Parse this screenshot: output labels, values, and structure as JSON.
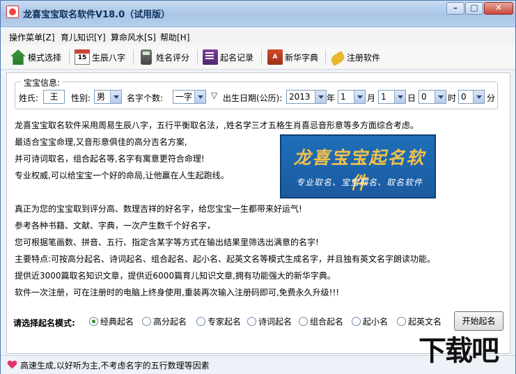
{
  "window": {
    "title": "龙喜宝宝取名软件V18.0（试用版）"
  },
  "menu": [
    {
      "label": "操作菜单[Z]"
    },
    {
      "label": "育儿知识[Y]"
    },
    {
      "label": "算命风水[S]"
    },
    {
      "label": "帮助[H]"
    }
  ],
  "toolbar": [
    {
      "label": "模式选择",
      "icon": "home-icon"
    },
    {
      "label": "生辰八字",
      "icon": "calendar-icon"
    },
    {
      "label": "姓名评分",
      "icon": "calculator-icon"
    },
    {
      "label": "起名记录",
      "icon": "record-book-icon"
    },
    {
      "label": "新华字典",
      "icon": "dictionary-icon"
    },
    {
      "label": "注册软件",
      "icon": "key-icon"
    }
  ],
  "baby_info": {
    "legend": "宝宝信息:",
    "surname_label": "姓氏:",
    "surname_value": "王",
    "gender_label": "性别:",
    "gender_value": "男",
    "name_count_label": "名字个数:",
    "name_count_value": "一字",
    "birth_label": "出生日期(公历):",
    "year": "2013",
    "year_unit": "年",
    "month": "1",
    "month_unit": "月",
    "day": "1",
    "day_unit": "日",
    "hour": "0",
    "hour_unit": "时",
    "minute": "0",
    "minute_unit": "分"
  },
  "description": [
    "龙喜宝宝取名软件采用周易生辰八字，五行平衡取名法，,姓名学三才五格生肖喜忌音形意等多方面综合考虑。",
    "最适合宝宝命理,又音形意俱佳的高分吉名方案,",
    "并可诗词取名，组合起名等,名字有寓意更符合命理!",
    "专业权威,可以给宝宝一个好的命局,让他赢在人生起跑线。",
    "真正为您的宝宝取到评分高、数理吉祥的好名字，给您宝宝一生都带来好运气!",
    "参考各种书籍、文献、字典，一次产生数千个好名字，",
    "您可根据笔画数、拼音、五行、指定含某字等方式在输出结果里筛选出满意的名字!",
    "主要特点:可按高分起名、诗词起名、组合起名、起小名、起英文名等模式生成名字，并且独有英文名字朗读功能。",
    "提供近3000篇取名知识文章，提供近6000篇育儿知识文章,拥有功能强大的新华字典。",
    "软件一次注册，可在注册时的电脑上终身使用,重装再次输入注册码即可,免费永久升级!!!"
  ],
  "banner": {
    "title": "龙喜宝宝起名软件",
    "subtitle": "专业取名、宝宝取名、取名软件"
  },
  "mode": {
    "label": "请选择起名模式:",
    "options": [
      "经典起名",
      "高分起名",
      "专家起名",
      "诗词起名",
      "组合起名",
      "起小名",
      "起英文名"
    ],
    "selected_index": 0,
    "start_label": "开始起名"
  },
  "status": {
    "text": "高速生成,以好听为主,不考虑名字的五行数理等因素"
  },
  "watermark": {
    "text": "下载吧"
  }
}
